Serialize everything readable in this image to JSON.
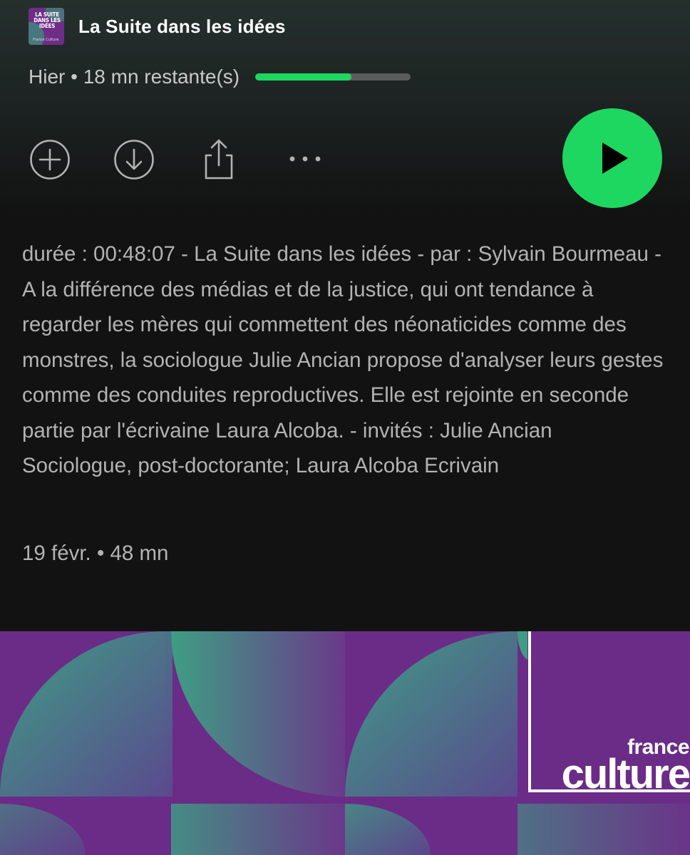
{
  "episode": {
    "show_title": "La Suite dans les idées",
    "thumbnail_text": "LA SUITE DANS LES IDÉES",
    "thumbnail_sub": "France Culture",
    "meta": "Hier • 18 mn restante(s)",
    "progress_fraction": 0.62,
    "description": "durée : 00:48:07 - La Suite dans les idées - par : Sylvain Bourmeau - A la différence des médias et de la justice, qui ont tendance à regarder les mères qui commettent des néonaticides comme des monstres, la sociologue Julie Ancian propose d'analyser leurs gestes comme des conduites reproductives. Elle est rejointe en seconde partie par l'écrivaine Laura Alcoba. - invités : Julie Ancian Sociologue, post-doctorante; Laura Alcoba Ecrivain",
    "date_duration": "19 févr. • 48 mn"
  },
  "actions": {
    "add_icon": "plus-circle-icon",
    "download_icon": "download-icon",
    "share_icon": "share-icon",
    "more_icon": "more-dots-icon",
    "play_icon": "play-icon"
  },
  "cover": {
    "brand_france": "france",
    "brand_culture": "culture"
  },
  "colors": {
    "background": "#121212",
    "accent_green": "#1ed760",
    "cover_purple": "#6a2c87",
    "cover_teal": "#3f8b7d"
  }
}
